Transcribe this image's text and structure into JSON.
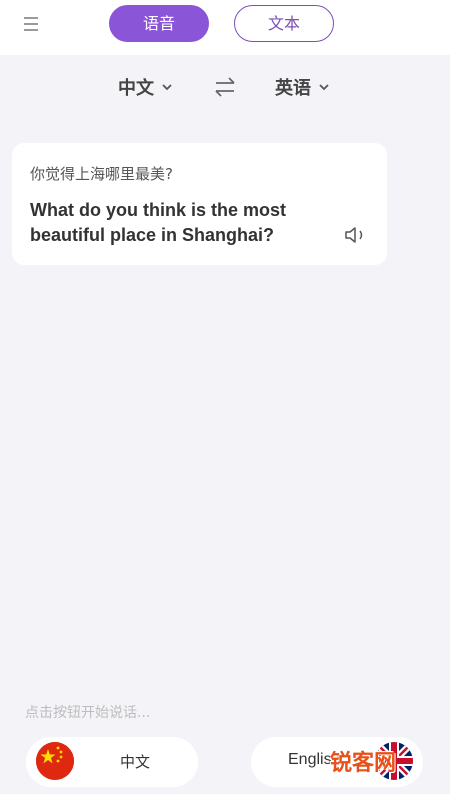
{
  "header": {
    "tabs": [
      {
        "label": "语音",
        "active": true
      },
      {
        "label": "文本",
        "active": false
      }
    ],
    "accent_color": "#8b55d8"
  },
  "languages": {
    "source": "中文",
    "target": "英语"
  },
  "translation": {
    "source_text": "你觉得上海哪里最美?",
    "target_text": "What do you think is the most beautiful place in Shanghai?"
  },
  "footer": {
    "hint": "点击按钮开始说话...",
    "buttons": [
      {
        "label": "中文",
        "icon": "china-flag-icon"
      },
      {
        "label": "English",
        "icon": "uk-flag-icon"
      }
    ]
  },
  "watermark": "锐客网"
}
